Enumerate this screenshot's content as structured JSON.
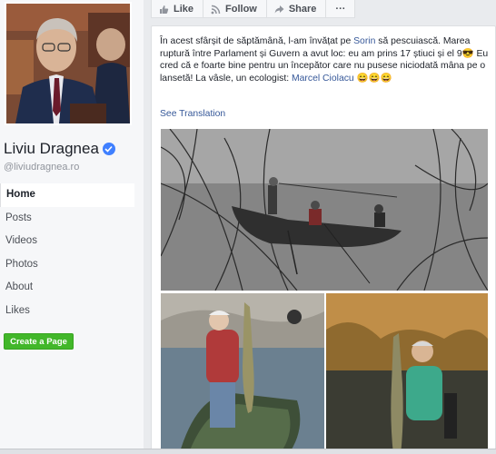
{
  "page": {
    "name": "Liviu Dragnea",
    "handle": "@liviudragnea.ro",
    "nav": [
      {
        "label": "Home",
        "active": true
      },
      {
        "label": "Posts"
      },
      {
        "label": "Videos"
      },
      {
        "label": "Photos"
      },
      {
        "label": "About"
      },
      {
        "label": "Likes"
      }
    ],
    "create_page_label": "Create a Page"
  },
  "actions": {
    "like": "Like",
    "follow": "Follow",
    "share": "Share",
    "more": "···"
  },
  "post": {
    "text_1": "În acest sfârșit de săptămână, l-am învățat pe ",
    "mention_1": "Sorin",
    "text_2": " să pescuiască. Marea ruptură între Parlament și Guvern a avut loc: eu am prins 17 știuci și el 9",
    "emoji_sunglasses": "😎",
    "text_3": " Eu cred că e foarte bine pentru un începător care nu pusese niciodată mâna pe o lansetă! La vâsle, un ecologist: ",
    "mention_2": "Marcel Ciolacu",
    "emoji_laugh": "😄😄😄",
    "see_translation": "See Translation"
  },
  "colors": {
    "link": "#365899",
    "green": "#42b72a",
    "verified": "#4080ff"
  }
}
